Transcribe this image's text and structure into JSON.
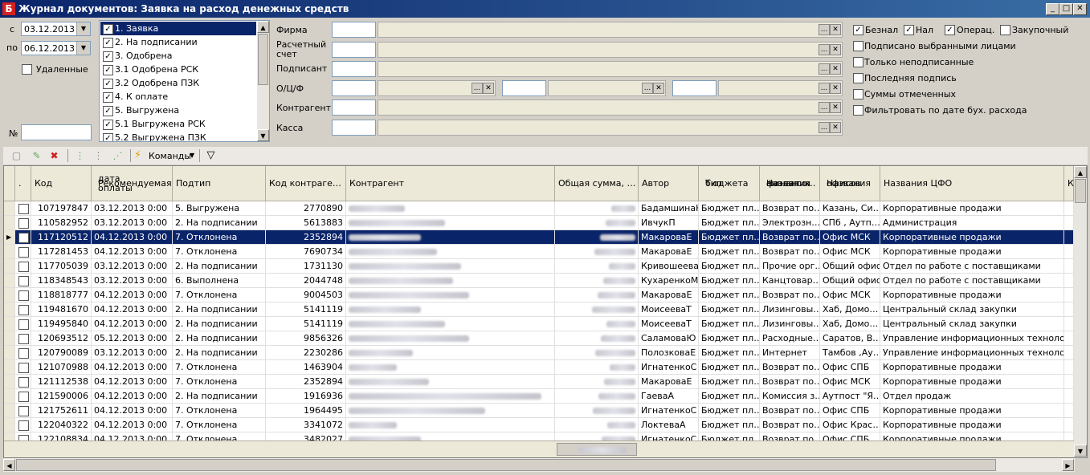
{
  "window": {
    "title": "Журнал документов: Заявка на расход денежных средств",
    "app_icon": "Б"
  },
  "dates": {
    "from_label": "с",
    "from_value": "03.12.2013",
    "to_label": "по",
    "to_value": "06.12.2013",
    "deleted_label": "Удаленные",
    "number_label": "№"
  },
  "statuses": [
    {
      "label": "1. Заявка",
      "checked": true,
      "selected": true
    },
    {
      "label": "2. На подписании",
      "checked": true
    },
    {
      "label": "3. Одобрена",
      "checked": true
    },
    {
      "label": "3.1 Одобрена РСК",
      "checked": true
    },
    {
      "label": "3.2 Одобрена ПЗК",
      "checked": true
    },
    {
      "label": "4. К оплате",
      "checked": true
    },
    {
      "label": "5. Выгружена",
      "checked": true
    },
    {
      "label": "5.1 Выгружена РСК",
      "checked": true
    },
    {
      "label": "5.2 Выгружена ПЗК",
      "checked": true
    }
  ],
  "filters": {
    "firma": "Фирма",
    "account_line1": "Расчетный",
    "account_line2": "счет",
    "signer": "Подписант",
    "ocf": "О/Ц/Ф",
    "counterparty": "Контрагент",
    "kassa": "Касса",
    "dots": "...",
    "clear": "✕"
  },
  "options": {
    "beznal": "Безнал",
    "nal": "Нал",
    "operac": "Операц.",
    "zakup": "Закупочный",
    "signed_selected": "Подписано выбранными лицами",
    "unsigned_only": "Только неподписанные",
    "last_signature": "Последняя подпись",
    "sums_marked": "Суммы отмеченных",
    "filter_by_date": "Фильтровать по дате бух. расхода"
  },
  "toolbar": {
    "commands": "Команды"
  },
  "columns": {
    "c0": ".",
    "kod": "Код",
    "date_l1": "Рекомендуемая",
    "date_l2": "дата оплаты",
    "subtype": "Подтип",
    "cpcode": "Код контраге…",
    "counterparty": "Контрагент",
    "total": "Общая сумма, …",
    "author": "Автор",
    "btype_l1": "Тип",
    "btype_l2": "бюджета",
    "fin_l1": "Названия",
    "fin_l2": "финансо…",
    "fin_l3": "аналитик",
    "off_l1": "Названия",
    "off_l2": "офисов",
    "cfo": "Названия ЦФО",
    "extra": "К"
  },
  "rows": [
    {
      "kod": "107197847",
      "date": "03.12.2013 0:00",
      "subtype": "5. Выгружена",
      "cpcode": "2770890",
      "author": "БадамшинаН",
      "btype": "Бюджет пл…",
      "fin": "Возврат по…",
      "office": "Казань, Си…",
      "cfo": "Корпоративные продажи"
    },
    {
      "kod": "110582952",
      "date": "03.12.2013 0:00",
      "subtype": "2. На подписании",
      "cpcode": "5613883",
      "author": "ИвчукП",
      "btype": "Бюджет пл…",
      "fin": "Электрозн…",
      "office": "СПб , Аутп…",
      "cfo": "Администрация"
    },
    {
      "kod": "117120512",
      "date": "04.12.2013 0:00",
      "subtype": "7. Отклонена",
      "cpcode": "2352894",
      "author": "МакароваЕ",
      "btype": "Бюджет пл…",
      "fin": "Возврат по…",
      "office": "Офис МСК",
      "cfo": "Корпоративные продажи",
      "selected": true
    },
    {
      "kod": "117281453",
      "date": "04.12.2013 0:00",
      "subtype": "7. Отклонена",
      "cpcode": "7690734",
      "author": "МакароваЕ",
      "btype": "Бюджет пл…",
      "fin": "Возврат по…",
      "office": "Офис МСК",
      "cfo": "Корпоративные продажи"
    },
    {
      "kod": "117705039",
      "date": "03.12.2013 0:00",
      "subtype": "2. На подписании",
      "cpcode": "1731130",
      "author": "Кривошеева",
      "btype": "Бюджет пл…",
      "fin": "Прочие орг…",
      "office": "Общий офис",
      "cfo": "Отдел по работе с поставщиками"
    },
    {
      "kod": "118348543",
      "date": "03.12.2013 0:00",
      "subtype": "6. Выполнена",
      "cpcode": "2044748",
      "author": "КухаренкоМ",
      "btype": "Бюджет пл…",
      "fin": "Канцтовар…",
      "office": "Общий офис",
      "cfo": "Отдел по работе с поставщиками"
    },
    {
      "kod": "118818777",
      "date": "04.12.2013 0:00",
      "subtype": "7. Отклонена",
      "cpcode": "9004503",
      "author": "МакароваЕ",
      "btype": "Бюджет пл…",
      "fin": "Возврат по…",
      "office": "Офис МСК",
      "cfo": "Корпоративные продажи"
    },
    {
      "kod": "119481670",
      "date": "04.12.2013 0:00",
      "subtype": "2. На подписании",
      "cpcode": "5141119",
      "author": "МоисееваТ",
      "btype": "Бюджет пл…",
      "fin": "Лизинговы…",
      "office": "Хаб, Домо…",
      "cfo": "Центральный склад закупки"
    },
    {
      "kod": "119495840",
      "date": "04.12.2013 0:00",
      "subtype": "2. На подписании",
      "cpcode": "5141119",
      "author": "МоисееваТ",
      "btype": "Бюджет пл…",
      "fin": "Лизинговы…",
      "office": "Хаб, Домо…",
      "cfo": "Центральный склад закупки"
    },
    {
      "kod": "120693512",
      "date": "05.12.2013 0:00",
      "subtype": "2. На подписании",
      "cpcode": "9856326",
      "author": "СаламоваЮ",
      "btype": "Бюджет пл…",
      "fin": "Расходные…",
      "office": "Саратов, В…",
      "cfo": "Управление информационных технологий"
    },
    {
      "kod": "120790089",
      "date": "03.12.2013 0:00",
      "subtype": "2. На подписании",
      "cpcode": "2230286",
      "author": "ПолозковаЕ",
      "btype": "Бюджет пл…",
      "fin": "Интернет",
      "office": "Тамбов ,Ау…",
      "cfo": "Управление информационных технологий"
    },
    {
      "kod": "121070988",
      "date": "04.12.2013 0:00",
      "subtype": "7. Отклонена",
      "cpcode": "1463904",
      "author": "ИгнатенкоС",
      "btype": "Бюджет пл…",
      "fin": "Возврат по…",
      "office": "Офис СПБ",
      "cfo": "Корпоративные продажи"
    },
    {
      "kod": "121112538",
      "date": "04.12.2013 0:00",
      "subtype": "7. Отклонена",
      "cpcode": "2352894",
      "author": "МакароваЕ",
      "btype": "Бюджет пл…",
      "fin": "Возврат по…",
      "office": "Офис МСК",
      "cfo": "Корпоративные продажи"
    },
    {
      "kod": "121590006",
      "date": "04.12.2013 0:00",
      "subtype": "2. На подписании",
      "cpcode": "1916936",
      "author": "ГаеваА",
      "btype": "Бюджет пл…",
      "fin": "Комиссия з…",
      "office": "Аутпост \"Я…",
      "cfo": "Отдел продаж"
    },
    {
      "kod": "121752611",
      "date": "04.12.2013 0:00",
      "subtype": "7. Отклонена",
      "cpcode": "1964495",
      "author": "ИгнатенкоС",
      "btype": "Бюджет пл…",
      "fin": "Возврат по…",
      "office": "Офис СПБ",
      "cfo": "Корпоративные продажи"
    },
    {
      "kod": "122040322",
      "date": "04.12.2013 0:00",
      "subtype": "7. Отклонена",
      "cpcode": "3341072",
      "author": "ЛоктеваА",
      "btype": "Бюджет пл…",
      "fin": "Возврат по…",
      "office": "Офис Крас…",
      "cfo": "Корпоративные продажи"
    },
    {
      "kod": "122108834",
      "date": "04.12.2013 0:00",
      "subtype": "7. Отклонена",
      "cpcode": "3482027",
      "author": "ИгнатенкоС",
      "btype": "Бюджет пл…",
      "fin": "Возврат по…",
      "office": "Офис СПБ",
      "cfo": "Корпоративные продажи"
    }
  ]
}
